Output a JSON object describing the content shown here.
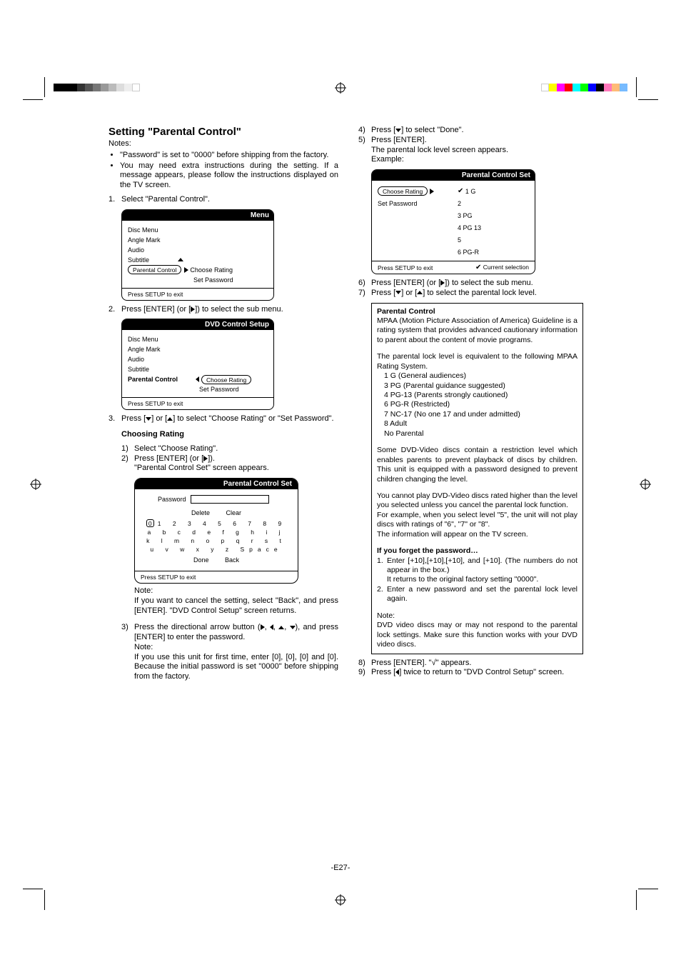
{
  "left": {
    "heading": "Setting \"Parental Control\"",
    "notes_label": "Notes:",
    "notes": [
      "\"Password\" is set to \"0000\" before shipping from the factory.",
      "You may need extra instructions during the setting. If a message appears, please follow the instructions displayed on the TV screen."
    ],
    "step1_n": "1.",
    "step1": "Select \"Parental Control\".",
    "menu1": {
      "title": "Menu",
      "items": [
        "Disc Menu",
        "Angle Mark",
        "Audio",
        "Subtitle"
      ],
      "sel": "Parental Control",
      "sub1": "Choose Rating",
      "sub2": "Set Password",
      "footer": "Press SETUP to exit"
    },
    "step2_n": "2.",
    "step2_a": "Press [ENTER] (or [",
    "step2_b": "]) to select the sub menu.",
    "menu2": {
      "title": "DVD Control Setup",
      "items": [
        "Disc Menu",
        "Angle Mark",
        "Audio",
        "Subtitle"
      ],
      "sel": "Parental Control",
      "sub_sel": "Choose Rating",
      "sub2": "Set Password",
      "footer": "Press SETUP to exit"
    },
    "step3_n": "3.",
    "step3_a": "Press [",
    "step3_b": "] or [",
    "step3_c": "] to select \"Choose Rating\" or \"Set Password\".",
    "choosing_heading": "Choosing Rating",
    "cr1_n": "1)",
    "cr1": "Select \"Choose Rating\".",
    "cr2_n": "2)",
    "cr2_a": "Press [ENTER] (or [",
    "cr2_b": "]).",
    "cr2_line2": "\"Parental Control Set\" screen appears.",
    "pws": {
      "title": "Parental Control Set",
      "pw_label": "Password",
      "delete": "Delete",
      "clear": "Clear",
      "row1": "1  2  3  4  5  6  7  8  9",
      "row2": "a  b  c  d  e  f   g  h   i   j",
      "row3": "k   l  m  n  o  p  q   r  s   t",
      "row4": "u  v  w  x  y  z   Space",
      "done": "Done",
      "back": "Back",
      "char0": "0",
      "footer": "Press SETUP to exit"
    },
    "note_label": "Note:",
    "note_cancel": "If you want to cancel the setting, select \"Back\", and press [ENTER]. \"DVD Control Setup\" screen returns.",
    "cr3_n": "3)",
    "cr3_a": "Press the directional arrow button (",
    "cr3_b": "), and press [ENTER] to enter the password.",
    "cr3_note_label": "Note:",
    "cr3_note": "If you use this unit for first time, enter [0], [0], [0] and [0]. Because the initial password is set \"0000\" before shipping from the factory."
  },
  "right": {
    "cr4_n": "4)",
    "cr4_a": "Press [",
    "cr4_b": "] to select \"Done\".",
    "cr5_n": "5)",
    "cr5": "Press [ENTER].",
    "cr5_line2": "The parental lock level screen appears.",
    "cr5_line3": "Example:",
    "osd3": {
      "title": "Parental Control Set",
      "sel": "Choose Rating",
      "row2": "Set Password",
      "opts": [
        "1 G",
        "2",
        "3 PG",
        "4 PG 13",
        "5",
        "6 PG-R"
      ],
      "footer_l": "Press SETUP to exit",
      "footer_r": "Current selection"
    },
    "cr6_n": "6)",
    "cr6_a": "Press [ENTER] (or [",
    "cr6_b": "]) to select the sub menu.",
    "cr7_n": "7)",
    "cr7_a": "Press [",
    "cr7_b": "] or [",
    "cr7_c": "] to select the parental lock level.",
    "box": {
      "h": "Parental Control",
      "p1": "MPAA (Motion Picture Association of America) Guideline is a rating system that provides advanced cautionary information to parent about the content of movie programs.",
      "p2": "The parental lock level is equivalent to the following MPAA Rating System.",
      "levels": [
        "1 G (General audiences)",
        "3 PG (Parental guidance suggested)",
        "4 PG-13 (Parents strongly cautioned)",
        "6 PG-R (Restricted)",
        "7 NC-17 (No one 17 and under admitted)",
        "8 Adult",
        "No Parental"
      ],
      "p3": "Some DVD-Video discs contain a restriction level which enables parents to prevent playback of discs by children. This unit is equipped with a password designed to prevent children changing the level.",
      "p4a": "You cannot play DVD-Video discs rated higher than the level you selected unless you cancel the parental lock function.",
      "p4b": "For example, when you select level \"5\", the unit will not play discs with ratings of \"6\", \"7\" or \"8\".",
      "p4c": "The information will appear on the TV screen.",
      "forgot_h": "If you forget the password…",
      "f1_n": "1.",
      "f1a": "Enter [+10],[+10],[+10], and [+10]. (The numbers do not appear in the box.)",
      "f1b": "It returns to the original factory setting \"0000\".",
      "f2_n": "2.",
      "f2": "Enter a new password and set the parental lock level again.",
      "note_label": "Note:",
      "note": "DVD video discs may or may not respond to the parental lock settings. Make sure this function works with your DVD video discs."
    },
    "cr8_n": "8)",
    "cr8": "Press [ENTER]. \"√\" appears.",
    "cr9_n": "9)",
    "cr9_a": "Press [",
    "cr9_b": "] twice to return to \"DVD Control Setup\" screen."
  },
  "footer": "-E27-",
  "colorbars": {
    "left": [
      "#000",
      "#000",
      "#000",
      "#333",
      "#555",
      "#777",
      "#999",
      "#bbb",
      "#ddd",
      "#eee",
      "#fff"
    ],
    "right": [
      "#fff",
      "#ff0",
      "#f0f",
      "#f00",
      "#0ff",
      "#0f0",
      "#00f",
      "#000",
      "#f7b",
      "#fb7",
      "#7bf"
    ]
  }
}
